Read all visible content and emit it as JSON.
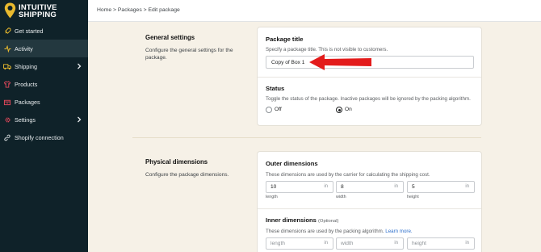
{
  "brand": {
    "line1": "INTUITIVE",
    "line2": "SHIPPING"
  },
  "sidebar": {
    "items": [
      {
        "label": "Get started",
        "icon": "rocket-icon"
      },
      {
        "label": "Activity",
        "icon": "activity-icon",
        "active": true
      },
      {
        "label": "Shipping",
        "icon": "truck-icon",
        "chevron": true
      },
      {
        "label": "Products",
        "icon": "shirt-icon"
      },
      {
        "label": "Packages",
        "icon": "box-icon"
      },
      {
        "label": "Settings",
        "icon": "gear-icon",
        "chevron": true
      },
      {
        "label": "Shopify connection",
        "icon": "link-icon"
      }
    ]
  },
  "breadcrumb": "Home > Packages > Edit package",
  "general": {
    "title": "General settings",
    "description": "Configure the general settings for the package.",
    "package_title": {
      "label": "Package title",
      "help": "Specify a package title. This is not visible to customers.",
      "value": "Copy of Box 1"
    },
    "status": {
      "label": "Status",
      "help": "Toggle the status of the package. Inactive packages will be ignored by the packing algorithm.",
      "off_label": "Off",
      "on_label": "On",
      "selected": "On"
    }
  },
  "physical": {
    "title": "Physical dimensions",
    "description": "Configure the package dimensions.",
    "outer": {
      "label": "Outer dimensions",
      "help": "These dimensions are used by the carrier for calculating the shipping cost.",
      "fields": [
        {
          "value": "10",
          "unit": "in",
          "sublabel": "length"
        },
        {
          "value": "8",
          "unit": "in",
          "sublabel": "width"
        },
        {
          "value": "5",
          "unit": "in",
          "sublabel": "height"
        }
      ]
    },
    "inner": {
      "label": "Inner dimensions",
      "optional": "(Optional)",
      "help": "These dimensions are used by the packing algorithm.",
      "learn_more": "Learn more.",
      "fields": [
        {
          "placeholder": "length",
          "unit": "in"
        },
        {
          "placeholder": "width",
          "unit": "in"
        },
        {
          "placeholder": "height",
          "unit": "in"
        }
      ]
    }
  },
  "colors": {
    "sidebar": "#0f2229",
    "accent": "#e8b92e",
    "arrow": "#e31b1b",
    "background": "#f6f1e7"
  }
}
